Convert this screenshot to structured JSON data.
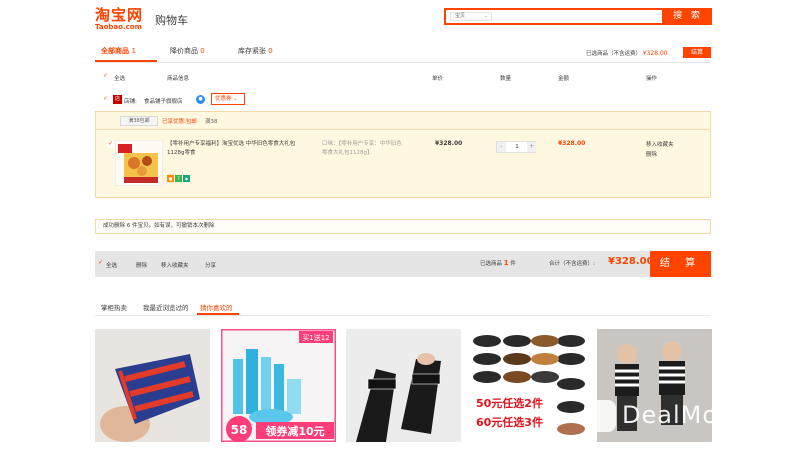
{
  "header": {
    "logo_cn": "淘宝网",
    "logo_en": "Taobao.com",
    "page_title": "购物车",
    "search_scope": "宝贝",
    "search_placeholder": "",
    "search_button": "搜 索"
  },
  "tabs": [
    {
      "label": "全部商品",
      "count": "1"
    },
    {
      "label": "降价商品",
      "count": "0"
    },
    {
      "label": "库存紧张",
      "count": "0"
    }
  ],
  "summary": {
    "selected_label": "已选商品（不含运费）",
    "selected_price": "¥328.00",
    "settle_button": "结算"
  },
  "columns": {
    "select_all": "全选",
    "product_info": "商品信息",
    "unit_price": "单价",
    "quantity": "数量",
    "amount": "金额",
    "operation": "操作"
  },
  "shop": {
    "label": "店铺:",
    "name": "食品铺子旗舰店",
    "coupon": "优惠券"
  },
  "promo": {
    "tag": "满38包邮",
    "text": "已享优惠:包邮",
    "gap": "满38"
  },
  "item": {
    "title": "【零补用户专享福利】淘宝优选 中华旧色零食大礼包1128g零食",
    "spec": "口味：【零补用户专享：中华旧色零食大礼包1128g】",
    "unit_price": "¥328.00",
    "quantity": "1",
    "total": "¥328.00",
    "op_favorite": "移入收藏夹",
    "op_delete": "删除"
  },
  "notice": "成功删除 6 件宝贝，如有误，可撤销本次删除",
  "bottom_bar": {
    "select_all": "全选",
    "delete": "删除",
    "move_fav": "移入收藏夹",
    "share": "分享",
    "selected_label": "已选商品",
    "selected_count": "1",
    "selected_unit": "件",
    "total_label": "合计（不含运费）:",
    "total": "¥328.00",
    "settle": "结 算"
  },
  "recommend_tabs": [
    {
      "label": "掌柜热卖"
    },
    {
      "label": "我最近浏览过的"
    },
    {
      "label": "猜你喜欢的"
    }
  ],
  "thumbs": {
    "t2_badge_top": "买1送12",
    "t2_price": "58",
    "t2_coupon": "领券减10元",
    "t4_line1": "50元任选2件",
    "t4_line2": "60元任选3件"
  },
  "watermark": "DealMoon",
  "colors": {
    "accent": "#ff4400",
    "item_bg": "#fff8e1",
    "bar_bg": "#e5e5e5"
  }
}
